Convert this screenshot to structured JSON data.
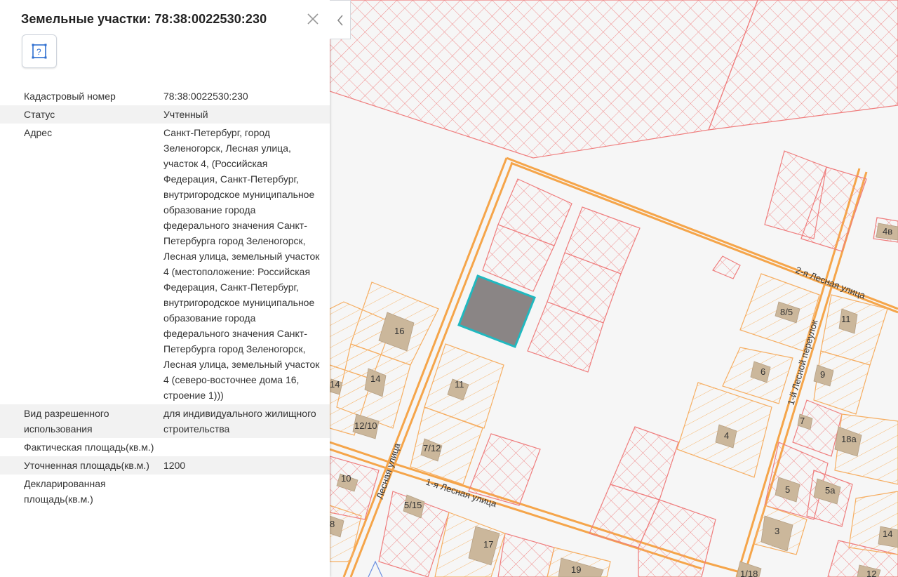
{
  "panel": {
    "title": "Земельные участки: 78:38:0022530:230",
    "close_icon": "close-icon",
    "legend_icon": "parcel-legend-icon",
    "legend_glyph": "?",
    "rows": [
      {
        "key": "Кадастровый номер",
        "value": "78:38:0022530:230",
        "alt": false
      },
      {
        "key": "Статус",
        "value": "Учтенный",
        "alt": true
      },
      {
        "key": "Адрес",
        "value": "Санкт-Петербург, город Зеленогорск, Лесная улица, участок 4, (Российская Федерация, Санкт-Петербург, внутригородское муниципальное образование города федерального значения Санкт-Петербурга город Зеленогорск, Лесная улица, земельный участок 4 (местоположение: Российская Федерация, Санкт-Петербург, внутригородское муниципальное образование города федерального значения Санкт-Петербурга город Зеленогорск, Лесная улица, земельный участок 4 (северо-восточнее дома 16, строение 1)))",
        "alt": false
      },
      {
        "key": "Вид разрешенного использования",
        "value": "для индивидуального жилищного строительства",
        "alt": true
      },
      {
        "key": "Фактическая площадь(кв.м.)",
        "value": "",
        "alt": false
      },
      {
        "key": "Уточненная площадь(кв.м.)",
        "value": "1200",
        "alt": true
      },
      {
        "key": "Декларированная площадь(кв.м.)",
        "value": "",
        "alt": false
      }
    ]
  },
  "collapse_icon": "chevron-left-icon",
  "map": {
    "colors": {
      "road": "#f5a54a",
      "parcel_hatch": "#ef7d7d",
      "parcel_orange": "#f7b36a",
      "building": "#cbb79b",
      "selected_fill": "#8a8585",
      "selected_border": "#21b8bf"
    },
    "streets": [
      {
        "id": "street-2ya-lesnaya",
        "name": "2-я Лесная улица"
      },
      {
        "id": "street-1ya-lesnaya",
        "name": "1-я Лесная улица"
      },
      {
        "id": "street-lesnaya",
        "name": "Лесная улица"
      },
      {
        "id": "street-1y-lesnoy-per",
        "name": "1-й Лесной переулок"
      }
    ],
    "house_numbers": [
      "16",
      "14",
      "14",
      "12/10",
      "11",
      "7/12",
      "10",
      "5/15",
      "17",
      "19",
      "8",
      "8/5",
      "11",
      "9",
      "6",
      "4",
      "7",
      "18а",
      "5",
      "5а",
      "3",
      "14",
      "12",
      "1/18",
      "4в"
    ]
  }
}
